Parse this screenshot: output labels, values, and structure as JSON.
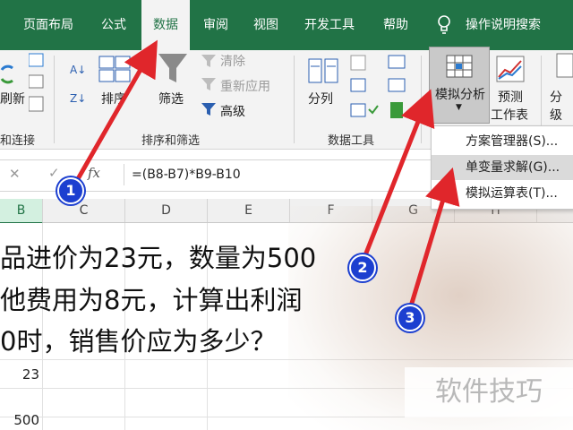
{
  "tabs": [
    {
      "label": "页面布局",
      "active": false
    },
    {
      "label": "公式",
      "active": false
    },
    {
      "label": "数据",
      "active": true
    },
    {
      "label": "审阅",
      "active": false
    },
    {
      "label": "视图",
      "active": false
    },
    {
      "label": "开发工具",
      "active": false
    },
    {
      "label": "帮助",
      "active": false
    }
  ],
  "tell_me": "操作说明搜索",
  "ribbon": {
    "left_partial_label": "刷新",
    "sort_label": "排序",
    "filter_label": "筛选",
    "clear_label": "清除",
    "reapply_label": "重新应用",
    "advanced_label": "高级",
    "split_label": "分列",
    "whatif_label": "模拟分析",
    "forecast_label_1": "预测",
    "forecast_label_2": "工作表",
    "outline_partial": "分级",
    "groups": {
      "connections": "和连接",
      "sort_filter": "排序和筛选",
      "data_tools": "数据工具"
    }
  },
  "formula_bar": {
    "cancel": "✕",
    "confirm": "✓",
    "fx": "fx",
    "formula": "=(B8-B7)*B9-B10"
  },
  "columns": [
    "B",
    "C",
    "D",
    "E",
    "F",
    "G",
    "H"
  ],
  "sheet_text": {
    "line1": "品进价为23元，数量为500",
    "line2": "他费用为8元，计算出利润",
    "line3": "0时，销售价应为多少？",
    "cell_23": "23",
    "cell_500": "500"
  },
  "whatif_menu": [
    {
      "label": "方案管理器(S)...",
      "highlighted": false
    },
    {
      "label": "单变量求解(G)...",
      "highlighted": true
    },
    {
      "label": "模拟运算表(T)...",
      "highlighted": false
    }
  ],
  "badges": [
    "1",
    "2",
    "3"
  ],
  "watermark": "软件技巧",
  "colors": {
    "excel_green": "#217346",
    "badge_blue": "#1c3fd0",
    "arrow_red": "#e0262b"
  }
}
